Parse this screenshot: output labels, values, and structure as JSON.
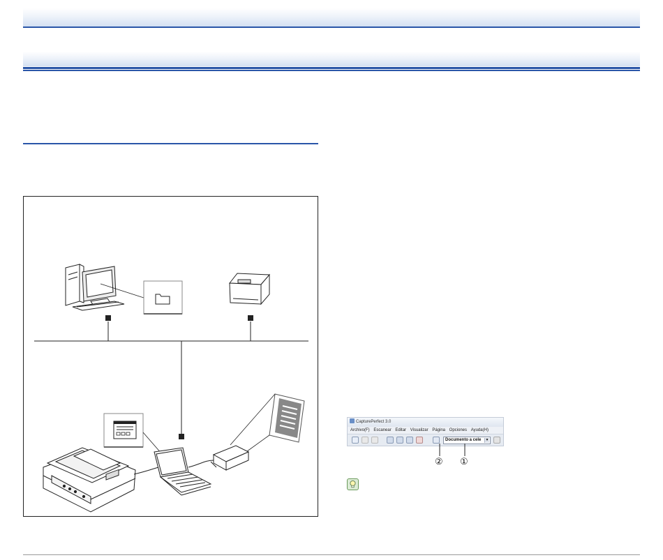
{
  "app": {
    "title": "CapturePerfect 3.0",
    "menu": [
      "Archivo(F)",
      "Escanear",
      "Editar",
      "Visualizar",
      "Página",
      "Opciones",
      "Ayuda(H)"
    ],
    "document_select": "Documento a cele",
    "select_arrow": "▼"
  },
  "callouts": {
    "one": "①",
    "two": "②"
  },
  "colors": {
    "accent": "#2a56a8",
    "band": "#d3e0f2"
  }
}
